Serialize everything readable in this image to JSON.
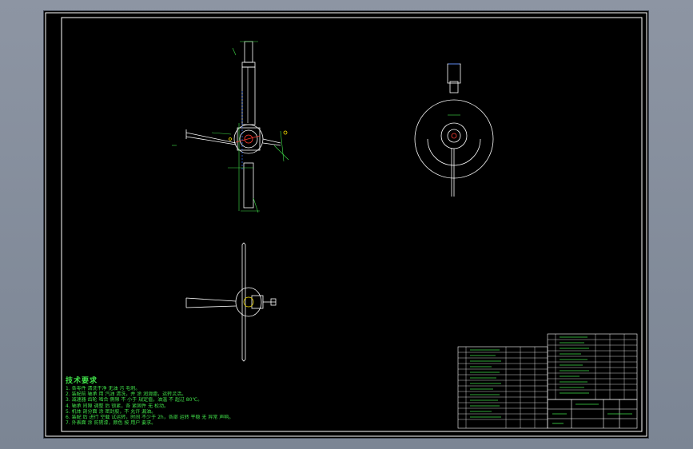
{
  "drawing": {
    "technical_requirements": {
      "title": "技术要求",
      "lines": [
        "1. 各零件 清洗干净 无油 污 毛刺。",
        "2. 装配前 轴承 用 汽油 清洗，并 涂 润滑脂，运转灵活。",
        "3. 减速器 齿轮 啮合 侧隙 不 小于 规定值，油温 不 超过 80℃。",
        "4. 轴承 间隙 调整 后 锁紧，各 紧固件 无 松动。",
        "5. 机体 剖分面 涂 密封胶，不 允许 漏油。",
        "6. 装配 后 进行 空载 试运转，时间 不少于 2h，各部 运转 平稳 无 异常 声响。",
        "7. 外表面 涂 防锈漆，颜色 按 用户 要求。"
      ]
    },
    "colors": {
      "background": "#000000",
      "frame": "#ffffff",
      "text_green": "#41e24a",
      "dim_green": "#25c93a",
      "accent_red": "#ff3b30",
      "accent_blue": "#2f6dff",
      "accent_yellow": "#ffe600"
    }
  }
}
